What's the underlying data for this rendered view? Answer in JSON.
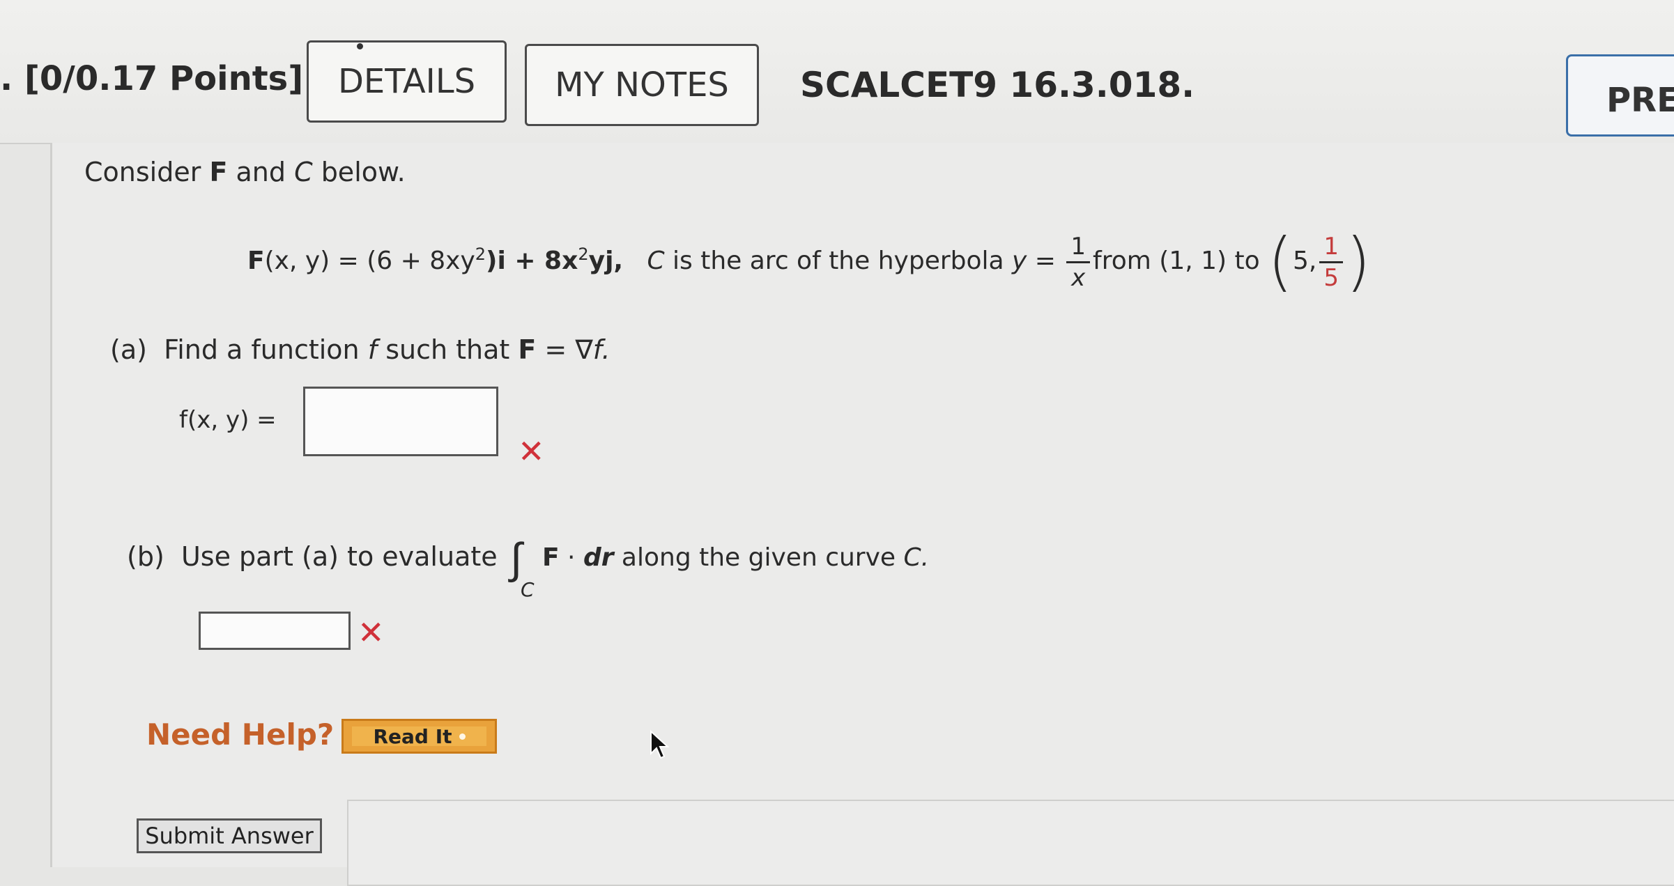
{
  "header": {
    "points": ". [0/0.17 Points]",
    "details_label": "DETAILS",
    "notes_label": "MY NOTES",
    "code": "SCALCET9 16.3.018.",
    "prev_label": "PREV"
  },
  "problem": {
    "intro_pre": "Consider ",
    "intro_F": "F",
    "intro_mid": " and ",
    "intro_C": "C",
    "intro_post": " below.",
    "F_lhs": "F",
    "F_args": "(x, y) = (6 + 8xy",
    "F_sq1": "2",
    "F_i": ")i + 8x",
    "F_sq2": "2",
    "F_yj": "yj,",
    "curve_C": "C",
    "curve_text": " is the arc of the hyperbola ",
    "curve_y": "y",
    "curve_eq": " = ",
    "frac_num": "1",
    "frac_den": "x",
    "from_text": "from (1, 1) to",
    "end_x": "5,",
    "end_num": "1",
    "end_den": "5"
  },
  "part_a": {
    "label": "(a)",
    "prompt_pre": "Find a function ",
    "prompt_f": "f",
    "prompt_mid": " such that ",
    "prompt_F": "F",
    "prompt_eq": " = ∇",
    "prompt_f2": "f.",
    "answer_lhs": "f(x, y) =",
    "answer_value": "",
    "status": "✕"
  },
  "part_b": {
    "label": "(b)",
    "prompt_pre": "Use part (a) to evaluate",
    "integral": "∫",
    "integral_sub": "C",
    "prompt_F": "F",
    "prompt_dot": " · ",
    "prompt_dr": "dr",
    "prompt_post": " along the given curve ",
    "prompt_C": "C.",
    "answer_value": "",
    "status": "✕"
  },
  "help": {
    "label": "Need Help?",
    "read_it": "Read It"
  },
  "submit_label": "Submit Answer",
  "colors": {
    "accent_help": "#c5612a",
    "error": "#d0313a",
    "read_it_bg": "#e9a23b",
    "prev_border": "#3a6fa8"
  }
}
